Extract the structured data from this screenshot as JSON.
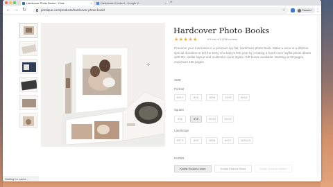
{
  "browser": {
    "tabs": [
      {
        "title": "Hardcover Photo Books - Cust..."
      },
      {
        "title": "Dashboard Content - Google S..."
      }
    ],
    "url": "printique.com/products/hardcover-photo-book/",
    "profile_label": "Paused"
  },
  "gallery": {
    "thumbnail_count": 6
  },
  "product": {
    "title": "Hardcover Photo Books",
    "stars": "★★★★★",
    "rating_text": "4.8 out of 5 (154 review)",
    "description": "Preserve your memories in a premium lay flat, hardcover photo book. Make a once-in-a-lifetime special donation or tell the story of a baby's first year by creating a hard cover layflat photo album with 80+ stellar layout and multicolor cover styles. Gift boxes available. Starting at 20 pages, maximum 100 pages."
  },
  "size": {
    "label": "SIZE",
    "portrait": {
      "label": "Portrait",
      "options": [
        "6X4.5",
        "8X6",
        "10X8",
        "12X9",
        "15X11"
      ]
    },
    "square": {
      "label": "Square",
      "options": [
        "6X6",
        "8X8",
        "10X10",
        "12X12"
      ],
      "selected": "8X8"
    },
    "landscape": {
      "label": "Landscape",
      "options": [
        "6X7.5",
        "8X9",
        "10X8",
        "8X12",
        "10X12.5"
      ]
    }
  },
  "paper": {
    "label": "PAPER",
    "options": [
      {
        "label": "Kodak Endura Luster",
        "state": "selected"
      },
      {
        "label": "Kodak Endura Gloss",
        "state": "normal"
      },
      {
        "label": "Kodak Endura Metallic",
        "state": "faded"
      }
    ]
  },
  "status_bar": {
    "text": "Waiting for cache..."
  },
  "colors": {
    "title": "#222222",
    "stars": "#e5a84a",
    "muted_text": "#8a8a8a",
    "selected_option_bg": "#ececec"
  }
}
